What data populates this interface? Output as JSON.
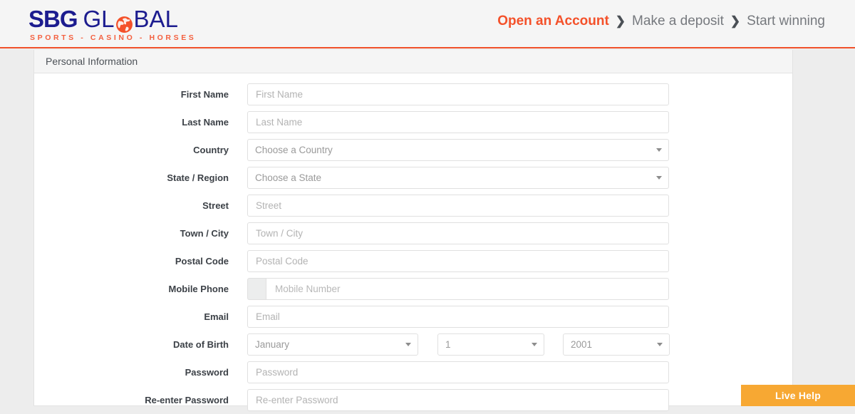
{
  "brand": {
    "logo_sbg": "SBG",
    "logo_gl": "GL",
    "logo_bal": "BAL",
    "globe_icon": "globe-icon",
    "tagline": "SPORTS - CASINO - HORSES",
    "navy": "#1c1c8f",
    "orange": "#f4512a"
  },
  "breadcrumb": {
    "steps": [
      {
        "label": "Open an Account",
        "active": true
      },
      {
        "label": "Make a deposit",
        "active": false
      },
      {
        "label": "Start winning",
        "active": false
      }
    ],
    "separator": "❯"
  },
  "panel": {
    "title": "Personal Information"
  },
  "form": {
    "first_name": {
      "label": "First Name",
      "placeholder": "First Name",
      "value": ""
    },
    "last_name": {
      "label": "Last Name",
      "placeholder": "Last Name",
      "value": ""
    },
    "country": {
      "label": "Country",
      "selected": "Choose a Country"
    },
    "state": {
      "label": "State / Region",
      "selected": "Choose a State"
    },
    "street": {
      "label": "Street",
      "placeholder": "Street",
      "value": ""
    },
    "town": {
      "label": "Town / City",
      "placeholder": "Town / City",
      "value": ""
    },
    "postal_code": {
      "label": "Postal Code",
      "placeholder": "Postal Code",
      "value": ""
    },
    "mobile_phone": {
      "label": "Mobile Phone",
      "prefix": "",
      "placeholder": "Mobile Number",
      "value": ""
    },
    "email": {
      "label": "Email",
      "placeholder": "Email",
      "value": ""
    },
    "date_of_birth": {
      "label": "Date of Birth",
      "month": "January",
      "day": "1",
      "year": "2001"
    },
    "password": {
      "label": "Password",
      "placeholder": "Password",
      "value": ""
    },
    "reenter_password": {
      "label": "Re-enter Password",
      "placeholder": "Re-enter Password",
      "value": ""
    }
  },
  "live_help": {
    "label": "Live Help",
    "color": "#f7a833"
  }
}
